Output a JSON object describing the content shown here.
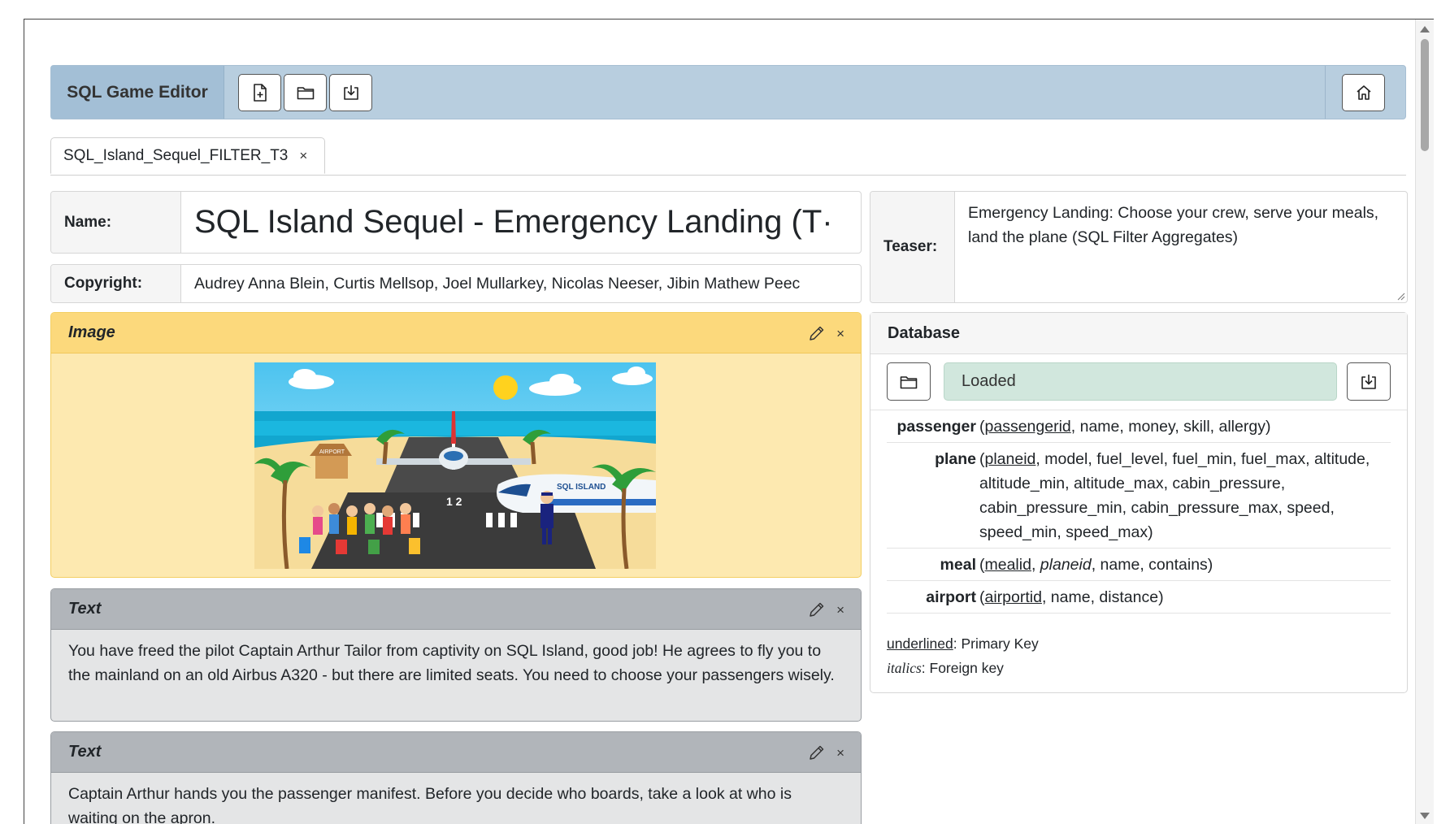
{
  "toolbar": {
    "brand": "SQL Game Editor",
    "buttons": [
      {
        "icon": "new-file-icon"
      },
      {
        "icon": "open-folder-icon"
      },
      {
        "icon": "download-icon"
      }
    ],
    "home_icon": "home-icon"
  },
  "tabs": [
    {
      "label": "SQL_Island_Sequel_FILTER_T3",
      "close": "×"
    }
  ],
  "fields": {
    "name_label": "Name:",
    "name_value": "SQL Island Sequel - Emergency Landing (T·",
    "copyright_label": "Copyright:",
    "copyright_value": "Audrey Anna Blein, Curtis Mellsop, Joel Mullarkey, Nicolas Neeser, Jibin Mathew Peec",
    "teaser_label": "Teaser:",
    "teaser_value": "Emergency Landing: Choose your crew, serve your meals, land the plane (SQL Filter Aggregates)"
  },
  "cards": {
    "image": {
      "title": "Image",
      "image_description": "SQL Island cartoon scene with beach, plane, runway and passengers",
      "image_text": "SQL ISLAND",
      "image_sign": "AIRPORT",
      "runway_number": "1 2"
    },
    "text1": {
      "title": "Text",
      "body": "You have freed the pilot Captain Arthur Tailor from captivity on SQL Island, good job! He agrees to fly you to the mainland on an old Airbus A320 - but there are limited seats. You need to choose your passengers wisely."
    },
    "text2": {
      "title": "Text",
      "body": "Captain Arthur hands you the passenger manifest. Before you decide who boards, take a look at who is waiting on the apron."
    },
    "close": "×"
  },
  "database": {
    "title": "Database",
    "status": "Loaded",
    "status_color": "#d1e7dd",
    "tables": [
      {
        "name": "passenger",
        "columns": [
          {
            "text": "passengerid",
            "style": "pk"
          },
          {
            "text": "name"
          },
          {
            "text": "money"
          },
          {
            "text": "skill"
          },
          {
            "text": "allergy"
          }
        ]
      },
      {
        "name": "plane",
        "columns": [
          {
            "text": "planeid",
            "style": "pk"
          },
          {
            "text": "model"
          },
          {
            "text": "fuel_level"
          },
          {
            "text": "fuel_min"
          },
          {
            "text": "fuel_max"
          },
          {
            "text": "altitude"
          },
          {
            "text": "altitude_min"
          },
          {
            "text": "altitude_max"
          },
          {
            "text": "cabin_pressure"
          },
          {
            "text": "cabin_pressure_min"
          },
          {
            "text": "cabin_pressure_max"
          },
          {
            "text": "speed"
          },
          {
            "text": "speed_min"
          },
          {
            "text": "speed_max"
          }
        ]
      },
      {
        "name": "meal",
        "columns": [
          {
            "text": "mealid",
            "style": "pk"
          },
          {
            "text": "planeid",
            "style": "fk"
          },
          {
            "text": "name"
          },
          {
            "text": "contains"
          }
        ]
      },
      {
        "name": "airport",
        "columns": [
          {
            "text": "airportid",
            "style": "pk"
          },
          {
            "text": "name"
          },
          {
            "text": "distance"
          }
        ]
      }
    ],
    "legend": {
      "pk_term": "underlined",
      "pk_desc": ": Primary Key",
      "fk_term": "italics",
      "fk_desc": ": Foreign key"
    }
  },
  "colors": {
    "toolbar_bg": "#b8cedf",
    "image_card": "#fcd97c",
    "text_card": "#b1b5ba",
    "loaded_bg": "#d1e7dd"
  }
}
